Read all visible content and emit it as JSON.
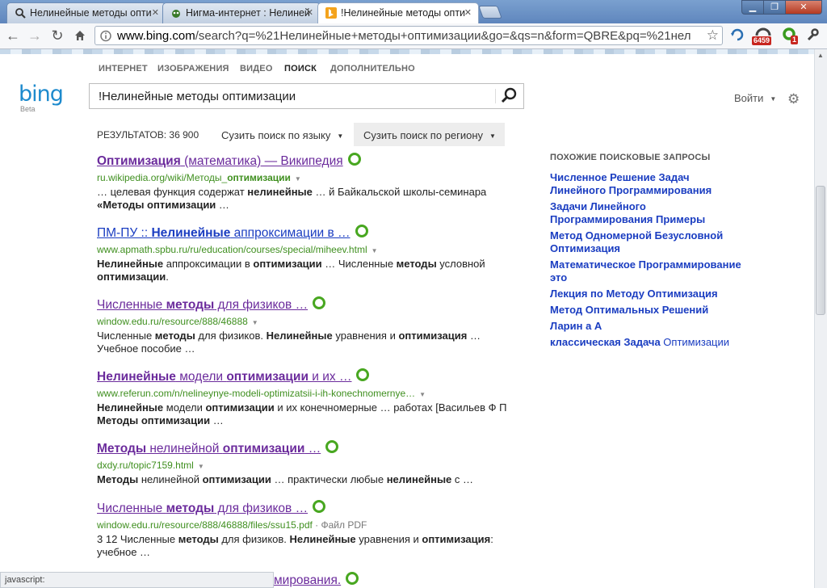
{
  "browser": {
    "tabs": [
      {
        "title": "Нелинейные методы опти"
      },
      {
        "title": "Нигма-интернет : Нелиней"
      },
      {
        "title": "!Нелинейные методы опти"
      }
    ],
    "url_domain": "www.bing.com",
    "url_rest": "/search?q=%21Нелинейные+методы+оптимизации&go=&qs=n&form=QBRE&pq=%21нел",
    "badge_count": "6459",
    "badge_small": "1",
    "status_text": "javascript:"
  },
  "nav": {
    "items": [
      "ИНТЕРНЕТ",
      "ИЗОБРАЖЕНИЯ",
      "ВИДЕО",
      "ПОИСК",
      "ДОПОЛНИТЕЛЬНО"
    ]
  },
  "logo": {
    "text": "bing",
    "sub": "Beta"
  },
  "search": {
    "query": "!Нелинейные методы оптимизации"
  },
  "header": {
    "signin": "Войти"
  },
  "results_bar": {
    "count": "РЕЗУЛЬТАТОВ: 36 900",
    "filter_language": "Сузить поиск по языку",
    "filter_region": "Сузить поиск по региону"
  },
  "results": [
    {
      "title_html": "<b>Оптимизация</b> (математика) — Википедия",
      "url_html": "ru.wikipedia.org/wiki/Методы_<b>оптимизации</b>",
      "snippet_html": "… целевая функция содержат <b>нелинейные</b> … й Байкальской школы-семинара<br><b>«Методы оптимизации</b> …"
    },
    {
      "title_html": "ПМ-ПУ :: <b>Нелинейные</b> аппроксимации в …",
      "url_html": "www.apmath.spbu.ru/ru/education/courses/special/miheev.html",
      "snippet_html": "<b>Нелинейные</b> аппроксимации в <b>оптимизации</b> … Численные <b>методы</b> условной<br><b>оптимизации</b>."
    },
    {
      "title_html": "Численные <b>методы</b> для физиков …",
      "url_html": "window.edu.ru/resource/888/46888",
      "snippet_html": "Численные <b>методы</b> для физиков. <b>Нелинейные</b> уравнения и <b>оптимизация</b> …<br>Учебное пособие …"
    },
    {
      "title_html": "<b>Нелинейные</b> модели <b>оптимизации</b> и их …",
      "url_html": "www.referun.com/n/nelineynye-modeli-optimizatsii-i-ih-konechnomernye…",
      "snippet_html": "<b>Нелинейные</b> модели <b>оптимизации</b> и их конечномерные … работах [Васильев Ф П<br><b>Методы оптимизации</b> …"
    },
    {
      "title_html": "<b>Методы</b> нелинейной <b>оптимизации</b> …",
      "url_html": "dxdy.ru/topic7159.html",
      "snippet_html": "<b>Методы</b> нелинейной <b>оптимизации</b> … практически любые <b>нелинейные</b> с …"
    },
    {
      "title_html": "Численные <b>методы</b> для физиков …",
      "url_html": "window.edu.ru/resource/888/46888/files/ssu15.pdf",
      "url_suffix": " · Файл PDF",
      "snippet_html": "3 12 Численные <b>методы</b> для физиков. <b>Нелинейные</b> уравнения и <b>оптимизация</b>:<br>учебное …"
    },
    {
      "title_html": "мирования.",
      "url_html": "",
      "snippet_html": ""
    }
  ],
  "related": {
    "heading": "ПОХОЖИЕ ПОИСКОВЫЕ ЗАПРОСЫ",
    "items_html": [
      "Численное Решение Задач Линейного Программирования",
      "Задачи Линейного Программирования Примеры",
      "Метод Одномерной Безусловной Оптимизация",
      "Математическое Программирование это",
      "Лекция по Методу Оптимизация",
      "Метод Оптимальных Решений",
      "Ларин а А",
      "классическая Задача <span class=\"norm\">Оптимизации</span>"
    ]
  },
  "colors": {
    "link": "#1a3dc1",
    "visited": "#6b2b9c",
    "url_green": "#3f8f1f",
    "brand": "#1d8acd"
  }
}
